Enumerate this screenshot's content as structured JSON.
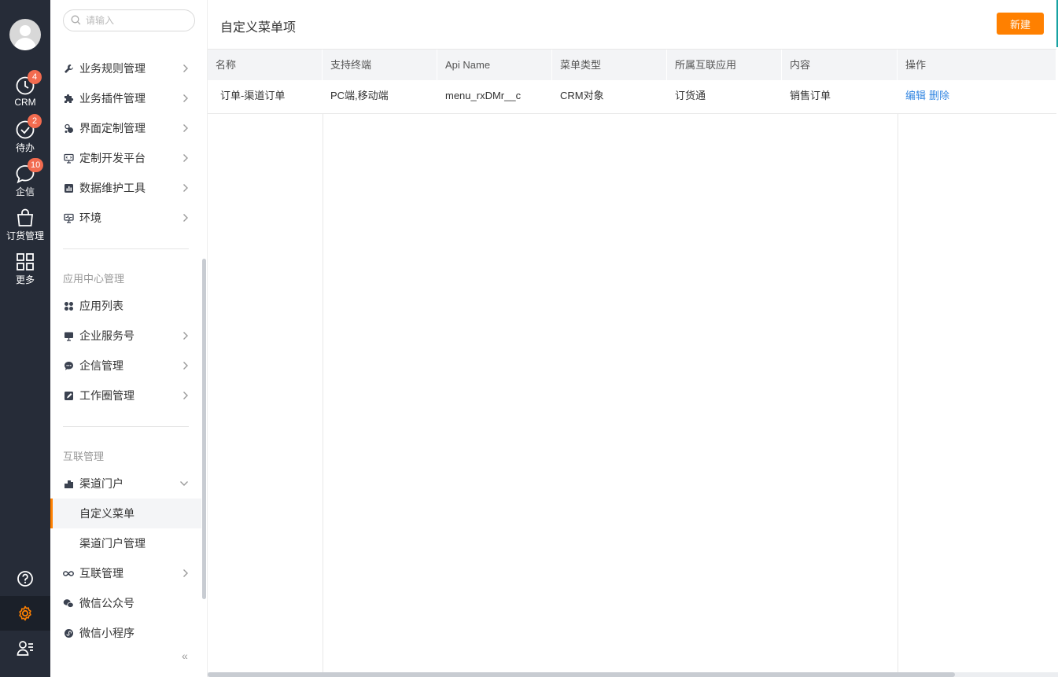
{
  "rail": {
    "items": [
      {
        "label": "CRM",
        "badge": "4",
        "icon": "clock-icon"
      },
      {
        "label": "待办",
        "badge": "2",
        "icon": "check-circle-icon"
      },
      {
        "label": "企信",
        "badge": "10",
        "icon": "chat-bubble-icon"
      },
      {
        "label": "订货管理",
        "badge": "",
        "icon": "shopping-bag-icon"
      },
      {
        "label": "更多",
        "badge": "",
        "icon": "grid-icon"
      }
    ],
    "bottom_icons": [
      "help-icon",
      "settings-icon",
      "user-list-icon"
    ]
  },
  "search": {
    "placeholder": "请输入"
  },
  "menu": {
    "items_top": [
      {
        "label": "业务规则管理",
        "icon": "wrench-icon"
      },
      {
        "label": "业务插件管理",
        "icon": "puzzle-icon"
      },
      {
        "label": "界面定制管理",
        "icon": "palette-icon"
      },
      {
        "label": "定制开发平台",
        "icon": "monitor-code-icon"
      },
      {
        "label": "数据维护工具",
        "icon": "bar-chart-icon"
      },
      {
        "label": "环境",
        "icon": "monitor-pulse-icon"
      }
    ],
    "group_app": "应用中心管理",
    "items_app": [
      {
        "label": "应用列表",
        "icon": "apps-icon"
      },
      {
        "label": "企业服务号",
        "icon": "monitor-icon"
      },
      {
        "label": "企信管理",
        "icon": "chat-icon"
      },
      {
        "label": "工作圈管理",
        "icon": "edit-square-icon"
      }
    ],
    "group_link": "互联管理",
    "channel_portal": "渠道门户",
    "sub_custom_menu": "自定义菜单",
    "sub_portal_manage": "渠道门户管理",
    "link_manage": "互联管理",
    "wechat_official": "微信公众号",
    "wechat_mini": "微信小程序",
    "collapse": "«"
  },
  "main": {
    "title": "自定义菜单项",
    "new_button": "新建",
    "columns": [
      "名称",
      "支持终端",
      "Api Name",
      "菜单类型",
      "所属互联应用",
      "内容",
      "操作"
    ],
    "rows": [
      {
        "name": "订单-渠道订单",
        "terminal": "PC端,移动端",
        "api_name": "menu_rxDMr__c",
        "menu_type": "CRM对象",
        "app": "订货通",
        "content": "销售订单",
        "edit": "编辑",
        "delete": "删除"
      }
    ]
  },
  "colors": {
    "accent": "#ff8000",
    "rail_bg": "#262c38",
    "badge": "#f26b4f",
    "link": "#3487e2"
  }
}
